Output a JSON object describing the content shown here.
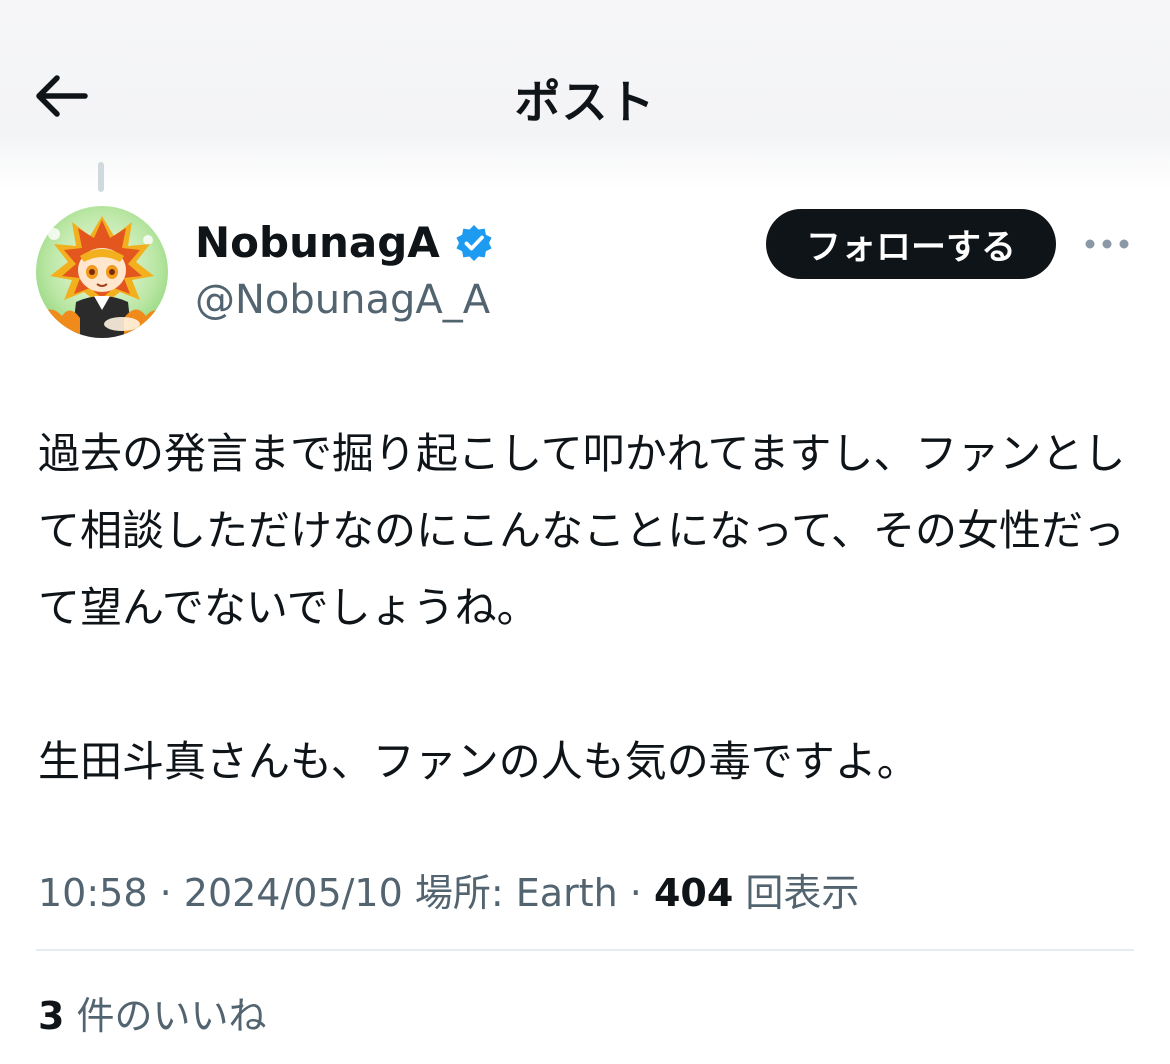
{
  "header": {
    "title": "ポスト",
    "back_icon": "arrow-left-icon"
  },
  "author": {
    "display_name": "NobunagA",
    "handle": "@NobunagA_A",
    "verified_icon": "verified-badge-icon",
    "verified_color": "#1d9bf0",
    "avatar": "avatar-image"
  },
  "actions": {
    "follow_label": "フォローする",
    "more_icon": "more-options-icon"
  },
  "tweet": {
    "paragraphs": [
      "過去の発言まで掘り起こして叩かれてますし、ファンとして相談しただけなのにこんなことになって、その女性だって望んでないでしょうね。",
      "生田斗真さんも、ファンの人も気の毒ですよ。"
    ]
  },
  "meta": {
    "time": "10:58",
    "separator": " · ",
    "date": "2024/05/10",
    "location_label": "場所:",
    "location": "Earth",
    "views_count": "404",
    "views_label": "回表示"
  },
  "engagement": {
    "likes_count": "3",
    "likes_label": "件のいいね"
  },
  "colors": {
    "text_primary": "#0f1419",
    "text_secondary": "#536471",
    "follow_bg": "#0f1419",
    "divider": "#e6ecf0"
  }
}
